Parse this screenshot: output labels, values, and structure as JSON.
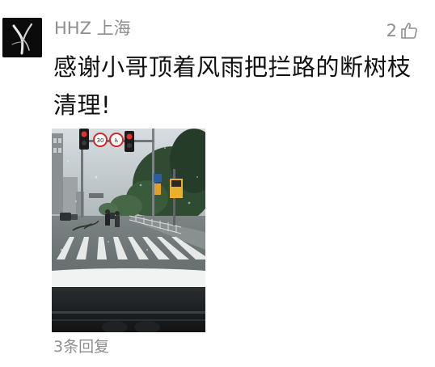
{
  "comment": {
    "user": {
      "name": "HHZ 上海",
      "avatar_icon": "calligraphy-avatar-icon"
    },
    "likes": {
      "count": "2",
      "icon": "thumbs-up-icon"
    },
    "text": "感谢小哥顶着风雨把拦路的断树枝清理!",
    "image": {
      "icon": "dashcam-photo",
      "sign_left": "30",
      "sign_right": "♿"
    },
    "replies_label": "3条回复"
  }
}
